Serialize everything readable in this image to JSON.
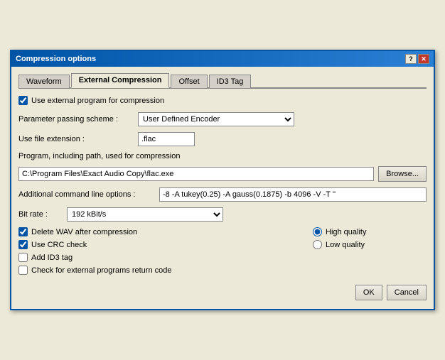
{
  "dialog": {
    "title": "Compression options",
    "help_btn": "?",
    "close_btn": "✕"
  },
  "tabs": [
    {
      "label": "Waveform",
      "active": false
    },
    {
      "label": "External Compression",
      "active": true
    },
    {
      "label": "Offset",
      "active": false
    },
    {
      "label": "ID3 Tag",
      "active": false
    }
  ],
  "form": {
    "use_external_checkbox_label": "Use external program for compression",
    "use_external_checked": true,
    "param_scheme_label": "Parameter passing scheme :",
    "param_scheme_value": "User Defined Encoder",
    "file_ext_label": "Use file extension :",
    "file_ext_value": ".flac",
    "program_label": "Program, including path, used for compression",
    "program_path": "C:\\Program Files\\Exact Audio Copy\\flac.exe",
    "browse_label": "Browse...",
    "additional_label": "Additional command line options :",
    "additional_value": "-8 -A tukey(0.25) -A gauss(0.1875) -b 4096 -V -T ''",
    "bitrate_label": "Bit rate :",
    "bitrate_value": "192 kBit/s",
    "delete_wav_label": "Delete WAV after compression",
    "delete_wav_checked": true,
    "use_crc_label": "Use CRC check",
    "use_crc_checked": true,
    "add_id3_label": "Add ID3 tag",
    "add_id3_checked": false,
    "check_return_label": "Check for external programs return code",
    "check_return_checked": false,
    "high_quality_label": "High quality",
    "low_quality_label": "Low quality",
    "high_quality_selected": true,
    "ok_label": "OK",
    "cancel_label": "Cancel"
  }
}
